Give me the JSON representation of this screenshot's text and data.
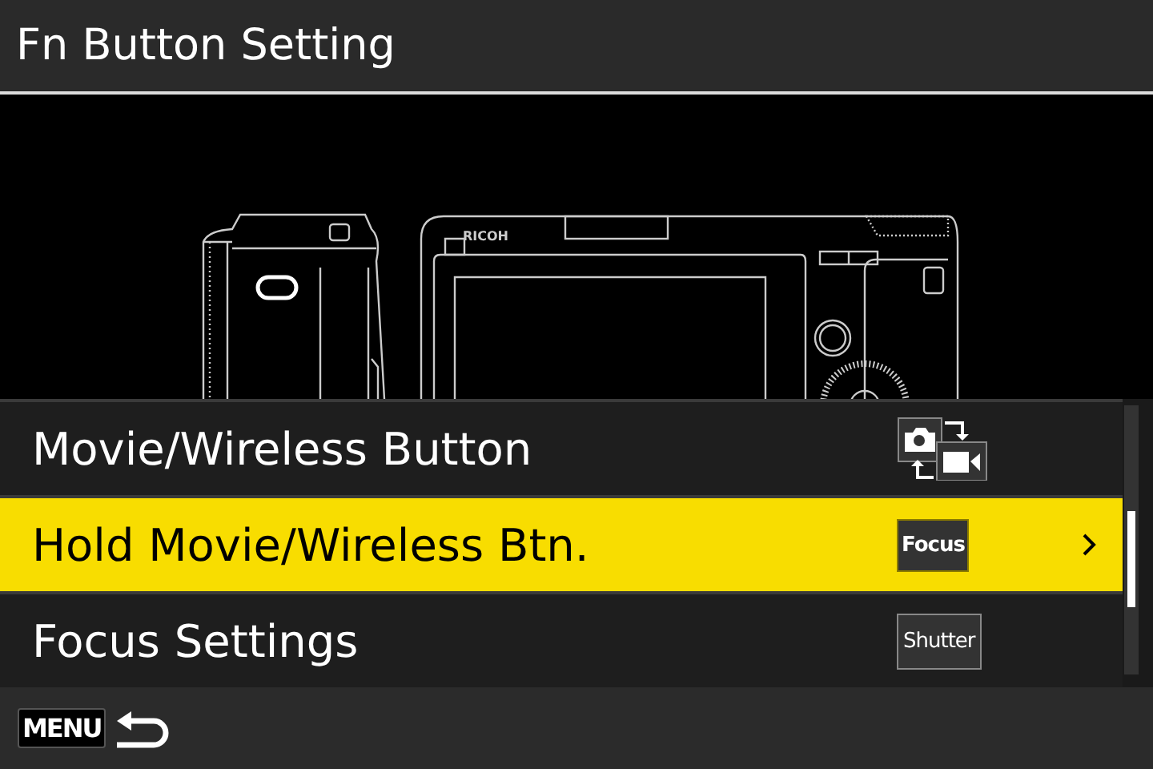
{
  "title": "Fn Button Setting",
  "illustration": {
    "brand_text": "RICOH"
  },
  "items": [
    {
      "label": "Movie/Wireless Button",
      "selected": false,
      "kind": "mode-switch"
    },
    {
      "label": "Hold Movie/Wireless Btn.",
      "selected": true,
      "kind": "badge",
      "badge": "Focus"
    },
    {
      "label": "Focus Settings",
      "selected": false,
      "kind": "badge",
      "badge": "Shutter"
    }
  ],
  "footer": {
    "menu_key": "MENU"
  }
}
